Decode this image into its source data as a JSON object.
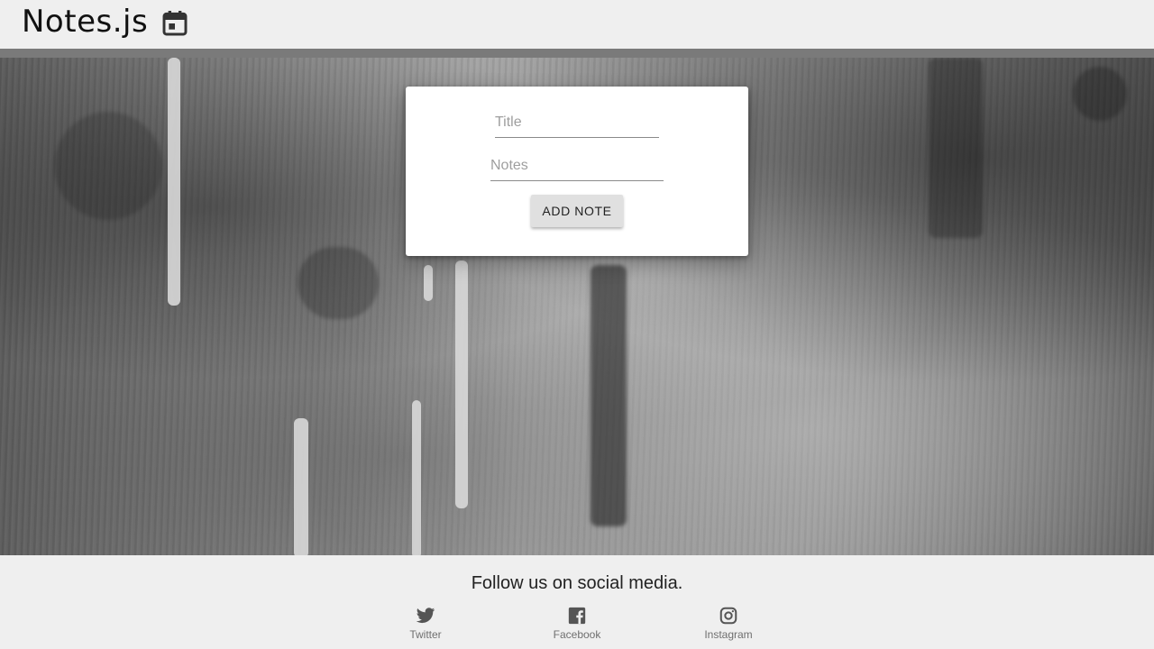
{
  "header": {
    "brand": "Notes.js",
    "icon": "calendar-icon"
  },
  "note_form": {
    "title_placeholder": "Title",
    "notes_placeholder": "Notes",
    "add_button_label": "ADD NOTE"
  },
  "footer": {
    "follow_text": "Follow us on social media.",
    "social": [
      {
        "label": "Twitter",
        "icon": "twitter-icon"
      },
      {
        "label": "Facebook",
        "icon": "facebook-icon"
      },
      {
        "label": "Instagram",
        "icon": "instagram-icon"
      }
    ]
  },
  "colors": {
    "header_bg": "#efefef",
    "header_bar": "#7a7a7a",
    "card_bg": "#ffffff",
    "button_bg": "#e0e0e0"
  }
}
